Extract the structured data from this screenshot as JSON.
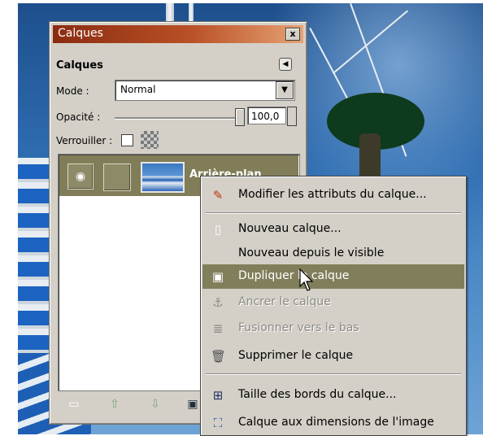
{
  "window": {
    "title": "Calques",
    "close_label": "x"
  },
  "panel": {
    "section_title": "Calques",
    "mode": {
      "label": "Mode :",
      "value": "Normal"
    },
    "opacity": {
      "label": "Opacité :",
      "value": "100,0",
      "level_percent": 100
    },
    "lock": {
      "label": "Verrouiller :",
      "checked": false
    }
  },
  "layers": [
    {
      "name": "Arrière-plan",
      "visible": true
    }
  ],
  "context_menu": {
    "items": [
      {
        "label": "Modifier les attributs du calque...",
        "icon": "pencil-icon",
        "enabled": true
      },
      {
        "label": "Nouveau calque...",
        "icon": "page-icon",
        "enabled": true
      },
      {
        "label": "Nouveau depuis le visible",
        "icon": "",
        "enabled": true
      },
      {
        "label": "Dupliquer le calque",
        "icon": "duplicate-icon",
        "enabled": true,
        "highlighted": true
      },
      {
        "label": "Ancrer le calque",
        "icon": "anchor-icon",
        "enabled": false
      },
      {
        "label": "Fusionner vers le bas",
        "icon": "merge-down-icon",
        "enabled": false
      },
      {
        "label": "Supprimer le calque",
        "icon": "trash-icon",
        "enabled": true
      },
      {
        "label": "Taille des bords du calque...",
        "icon": "layer-size-icon",
        "enabled": true
      },
      {
        "label": "Calque aux dimensions de l'image",
        "icon": "layer-to-image-icon",
        "enabled": true
      }
    ]
  },
  "colors": {
    "title_gradient_start": "#8a2c10",
    "title_gradient_end": "#e6a274",
    "highlight": "#817f5b",
    "panel_bg": "#d4d0c8"
  }
}
